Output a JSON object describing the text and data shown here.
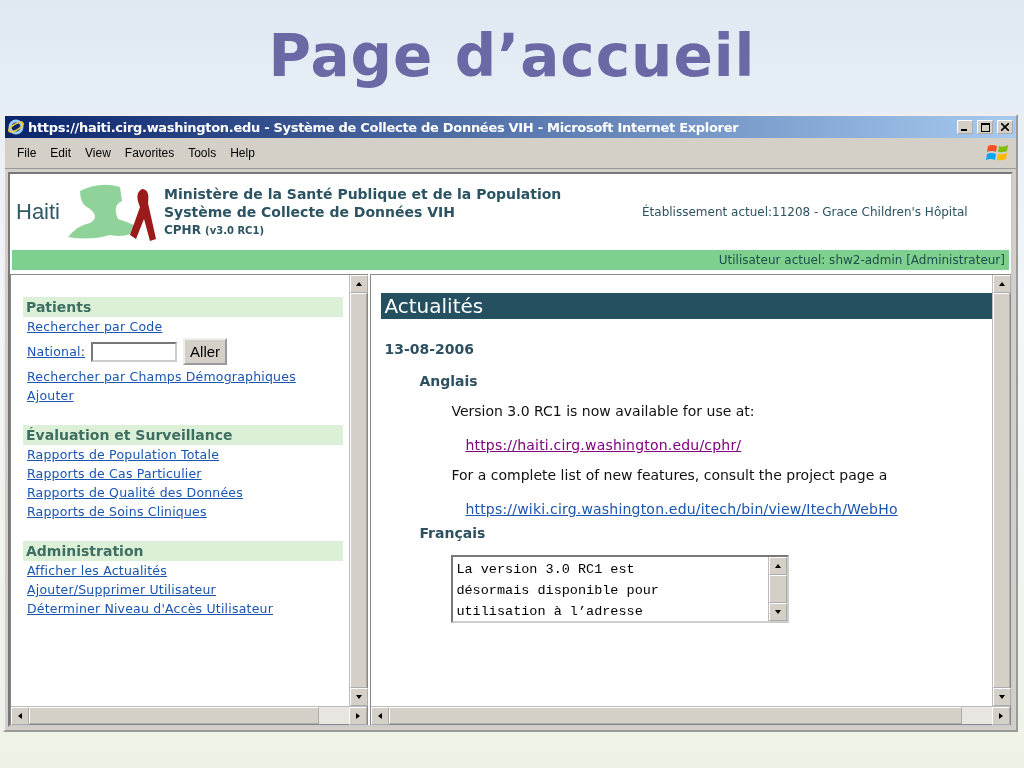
{
  "slide": {
    "title": "Page d’accueil"
  },
  "window": {
    "title": "https://haiti.cirg.washington.edu - Système de Collecte de Données VIH - Microsoft Internet Explorer"
  },
  "menu": [
    "File",
    "Edit",
    "View",
    "Favorites",
    "Tools",
    "Help"
  ],
  "header": {
    "logo_text": "Haiti",
    "lines": [
      "Ministère de la Santé Publique et de la Population",
      "Système de Collecte de Données VIH"
    ],
    "app": "CPHR",
    "version": "(v3.0 RC1)",
    "facility": "Établissement actuel:11208 - Grace Children's Hôpital",
    "user": "Utilisateur actuel: shw2-admin [Administrateur]"
  },
  "sidebar": [
    {
      "title": "Patients",
      "items": [
        {
          "kind": "link",
          "label": "Rechercher par Code"
        },
        {
          "kind": "search",
          "label": "National:",
          "button": "Aller"
        },
        {
          "kind": "link",
          "label": "Rechercher par Champs Démographiques"
        },
        {
          "kind": "link",
          "label": "Ajouter"
        }
      ]
    },
    {
      "title": "Évaluation et Surveillance",
      "items": [
        {
          "kind": "link",
          "label": "Rapports de Population Totale"
        },
        {
          "kind": "link",
          "label": "Rapports de Cas Particulier"
        },
        {
          "kind": "link",
          "label": "Rapports de Qualité des Données"
        },
        {
          "kind": "link",
          "label": "Rapports de Soins Cliniques"
        }
      ]
    },
    {
      "title": "Administration",
      "items": [
        {
          "kind": "link",
          "label": "Afficher les Actualités"
        },
        {
          "kind": "link",
          "label": "Ajouter/Supprimer Utilisateur"
        },
        {
          "kind": "link",
          "label": "Déterminer Niveau d'Accès Utilisateur"
        }
      ]
    }
  ],
  "news": {
    "title": "Actualités",
    "date": "13-08-2006",
    "sections": [
      {
        "language": "Anglais",
        "blocks": [
          {
            "kind": "text",
            "text": "Version 3.0 RC1 is now available for use at:"
          },
          {
            "kind": "link",
            "text": "https://haiti.cirg.washington.edu/cphr/",
            "visited": true
          },
          {
            "kind": "text",
            "text": "For a complete list of new features, consult the project page a"
          },
          {
            "kind": "link",
            "text": "https://wiki.cirg.washington.edu/itech/bin/view/Itech/WebHo",
            "visited": false
          }
        ]
      },
      {
        "language": "Français",
        "blocks": [
          {
            "kind": "textarea",
            "lines": [
              "La version 3.0 RC1 est",
              "désormais disponible pour",
              "utilisation à l’adresse"
            ]
          }
        ]
      }
    ]
  }
}
